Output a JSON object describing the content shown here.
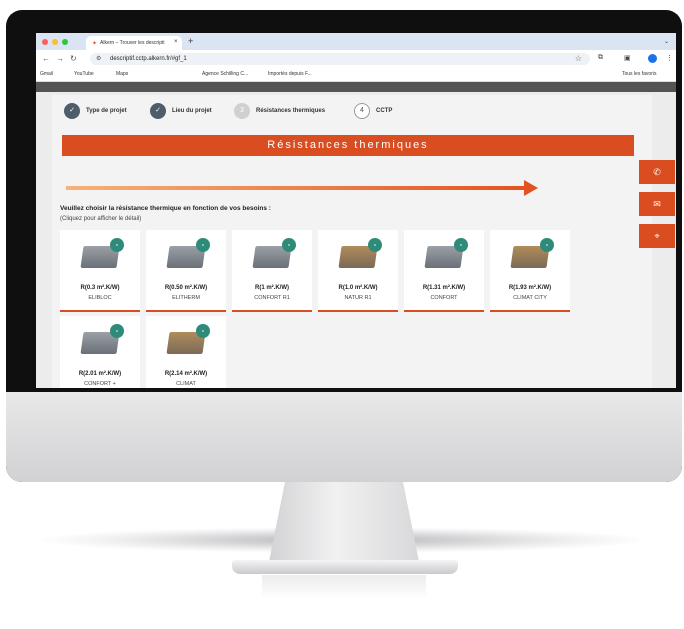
{
  "browser": {
    "tab_title": "Alkern – Trouver les descripti",
    "url": "descriptif.cctp.alkern.fr/#gf_1",
    "bookmarks": [
      "Gmail",
      "YouTube",
      "Maps",
      "Agence Schilling C...",
      "Importés depuis F...",
      "Tous les favoris"
    ]
  },
  "steps": [
    {
      "num": "✓",
      "label": "Type de projet"
    },
    {
      "num": "✓",
      "label": "Lieu du projet"
    },
    {
      "num": "3",
      "label": "Résistances thermiques"
    },
    {
      "num": "4",
      "label": "CCTP"
    }
  ],
  "banner": "Résistances thermiques",
  "question": "Veuillez choisir la résistance thermique en fonction de vos besoins :",
  "hint": "(Cliquez pour afficher le détail)",
  "products": [
    {
      "r": "R(0.3 m².K/W)",
      "name": "ELIBLOC"
    },
    {
      "r": "R(0.50 m².K/W)",
      "name": "ELITHERM"
    },
    {
      "r": "R(1 m².K/W)",
      "name": "CONFORT R1"
    },
    {
      "r": "R(1.0 m².K/W)",
      "name": "NATUR R1"
    },
    {
      "r": "R(1.31 m².K/W)",
      "name": "CONFORT"
    },
    {
      "r": "R(1.93 m².K/W)",
      "name": "CLIMAT CITY"
    },
    {
      "r": "R(2.01 m².K/W)",
      "name": "CONFORT +"
    },
    {
      "r": "R(2.14 m².K/W)",
      "name": "CLIMAT"
    }
  ],
  "colors": {
    "accent": "#d94d21",
    "step_done": "#4e5d6c"
  }
}
